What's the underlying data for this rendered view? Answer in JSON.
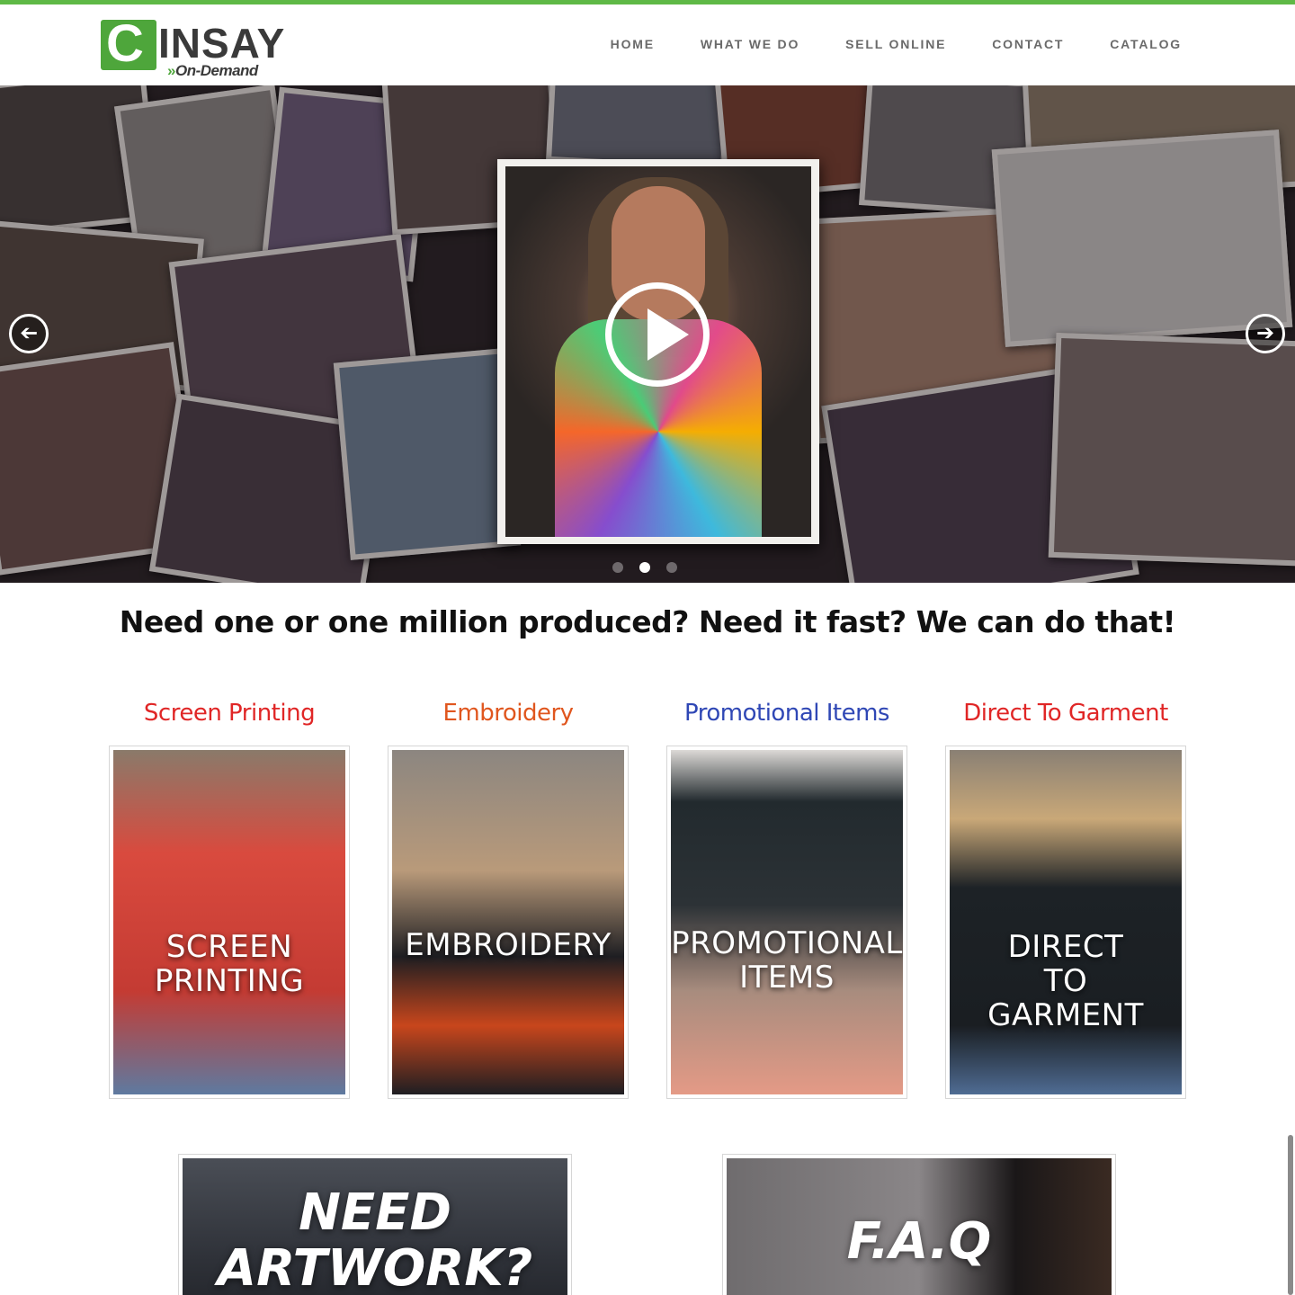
{
  "brand": {
    "logo_letter": "C",
    "logo_word": "INSAY",
    "logo_arrows": "»",
    "logo_sub": "On-Demand",
    "colors": {
      "accent": "#5fb946",
      "logo_green": "#4ea63b",
      "text": "#3a3a3a"
    }
  },
  "nav": {
    "items": [
      {
        "label": "HOME"
      },
      {
        "label": "WHAT WE DO"
      },
      {
        "label": "SELL ONLINE"
      },
      {
        "label": "CONTACT"
      },
      {
        "label": "CATALOG"
      }
    ]
  },
  "hero": {
    "prev_icon": "arrow-left-circle-icon",
    "next_icon": "arrow-right-circle-icon",
    "prev_glyph": "➔",
    "next_glyph": "➔",
    "play_icon": "play-icon",
    "slide_count": 3,
    "active_slide": 2
  },
  "tagline": "Need one or one million produced? Need it fast? We can do that!",
  "services": [
    {
      "title": "Screen Printing",
      "title_color": "#e02626",
      "image_text": [
        "SCREEN",
        "PRINTING"
      ]
    },
    {
      "title": "Embroidery",
      "title_color": "#e0561e",
      "image_text": [
        "EMBROIDERY"
      ]
    },
    {
      "title": "Promotional Items",
      "title_color": "#2f47b5",
      "image_text": [
        "PROMOTIONAL",
        "ITEMS"
      ]
    },
    {
      "title": "Direct To Garment",
      "title_color": "#e02626",
      "image_text": [
        "DIRECT",
        "TO",
        "GARMENT"
      ]
    }
  ],
  "promos": [
    {
      "image_text": [
        "NEED",
        "ARTWORK?"
      ]
    },
    {
      "image_text": [
        "F.A.Q"
      ]
    }
  ]
}
